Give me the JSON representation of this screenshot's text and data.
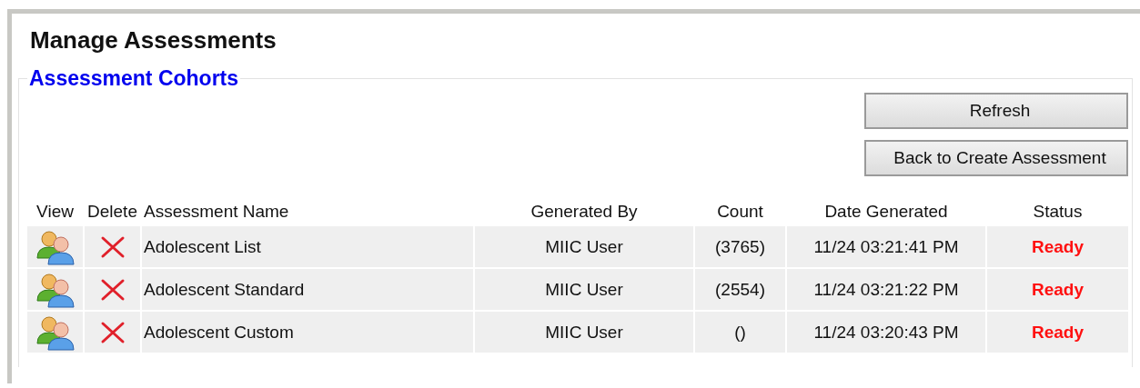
{
  "page": {
    "title": "Manage Assessments"
  },
  "section": {
    "legend": "Assessment Cohorts"
  },
  "buttons": [
    "Refresh",
    "Back to Create Assessment"
  ],
  "table": {
    "columns": [
      "View",
      "Delete",
      "Assessment Name",
      "Generated By",
      "Count",
      "Date Generated",
      "Status"
    ],
    "rows": [
      {
        "name": "Adolescent List",
        "generated_by": "MIIC User",
        "count": "(3765)",
        "date": "11/24 03:21:41 PM",
        "status": "Ready"
      },
      {
        "name": "Adolescent Standard",
        "generated_by": "MIIC User",
        "count": "(2554)",
        "date": "11/24 03:21:22 PM",
        "status": "Ready"
      },
      {
        "name": "Adolescent Custom",
        "generated_by": "MIIC User",
        "count": "()",
        "date": "11/24 03:20:43 PM",
        "status": "Ready"
      }
    ]
  }
}
